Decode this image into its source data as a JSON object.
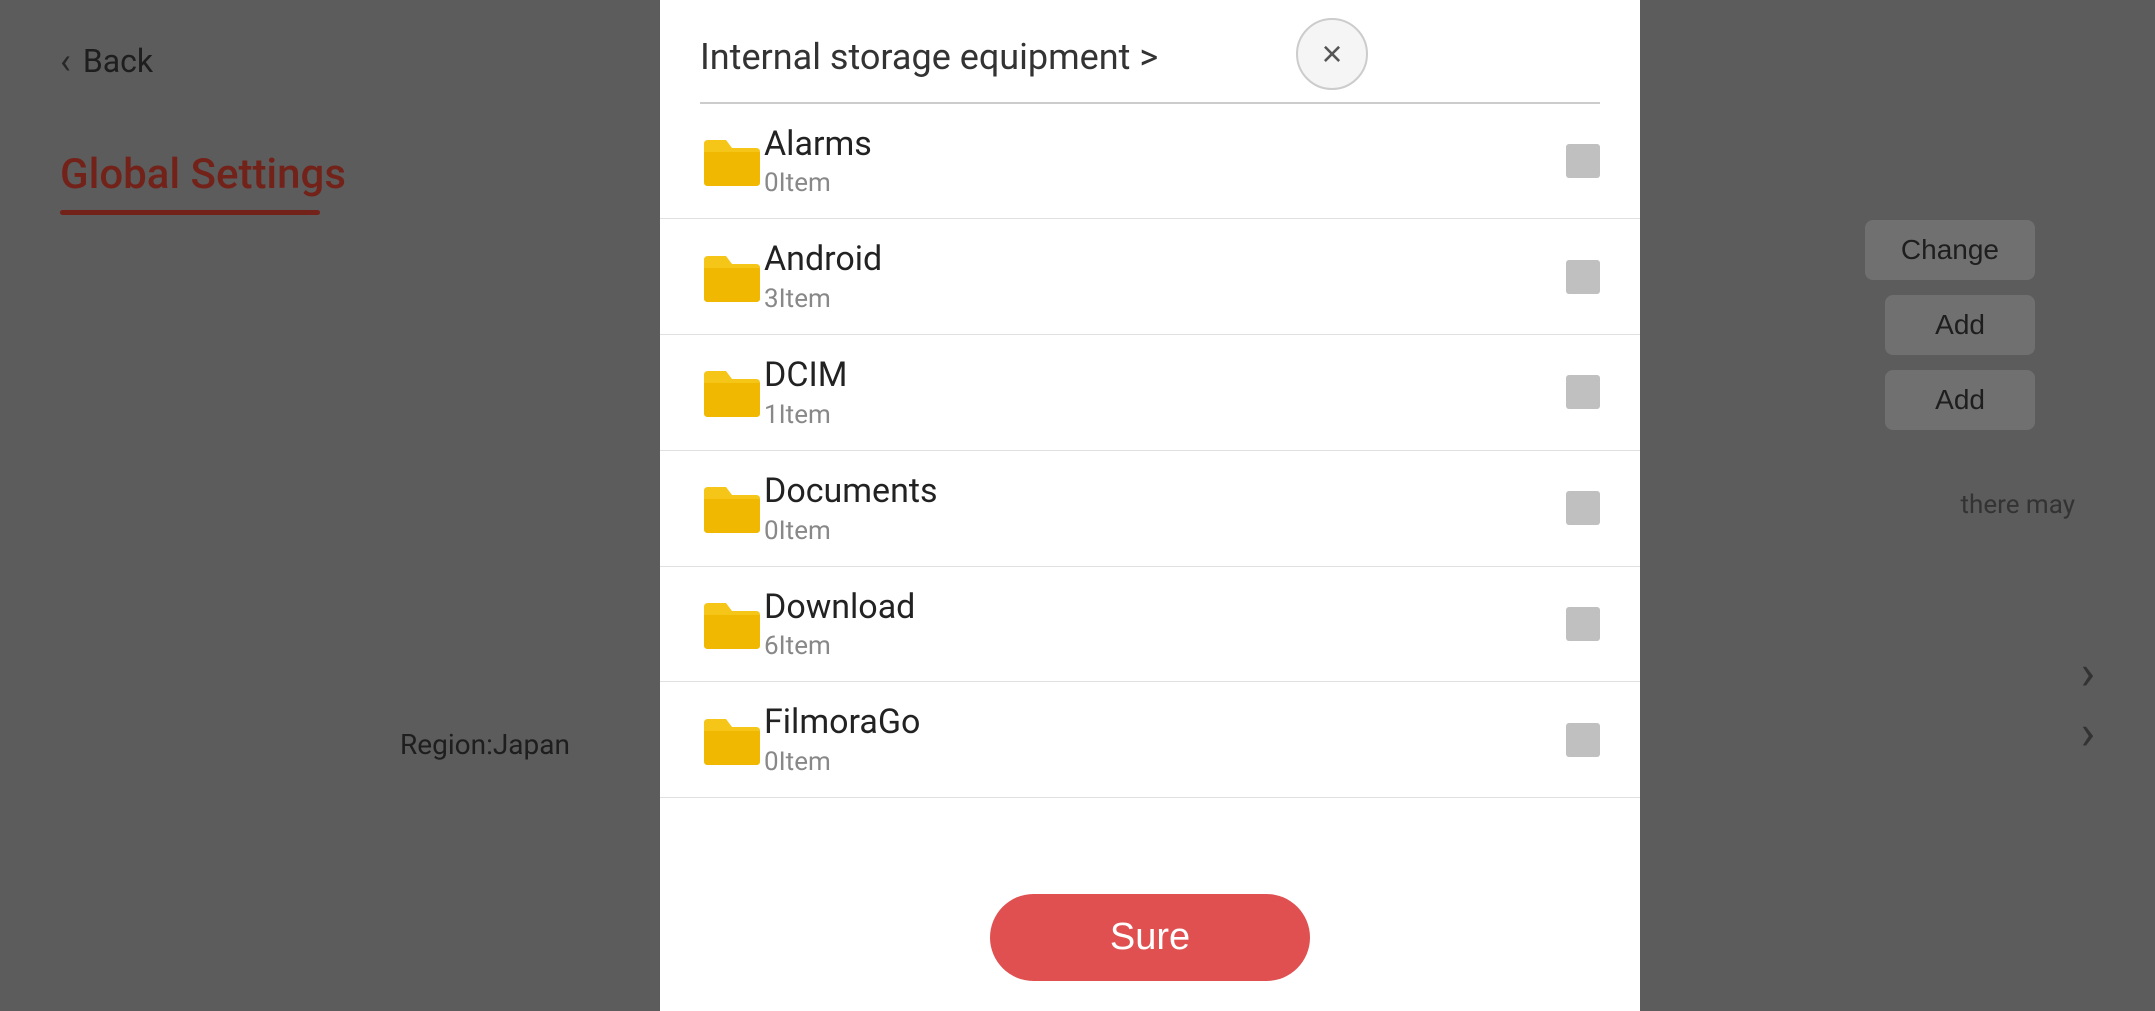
{
  "background": {
    "back_label": "Back",
    "global_settings_label": "Global Settings",
    "change_btn": "Change",
    "add_btn1": "Add",
    "add_btn2": "Add",
    "there_may_text": "there may",
    "region_label": "Region:Japan"
  },
  "modal": {
    "title": "Internal storage equipment >",
    "close_icon": "×",
    "folders": [
      {
        "name": "Alarms",
        "count": "0Item"
      },
      {
        "name": "Android",
        "count": "3Item"
      },
      {
        "name": "DCIM",
        "count": "1Item"
      },
      {
        "name": "Documents",
        "count": "0Item"
      },
      {
        "name": "Download",
        "count": "6Item"
      },
      {
        "name": "FilmoraGo",
        "count": "0Item"
      }
    ],
    "sure_btn": "Sure"
  },
  "colors": {
    "folder_yellow": "#f5c518",
    "folder_yellow_dark": "#e0a800",
    "accent_red": "#e05050",
    "checkbox_gray": "#c0c0c0"
  }
}
